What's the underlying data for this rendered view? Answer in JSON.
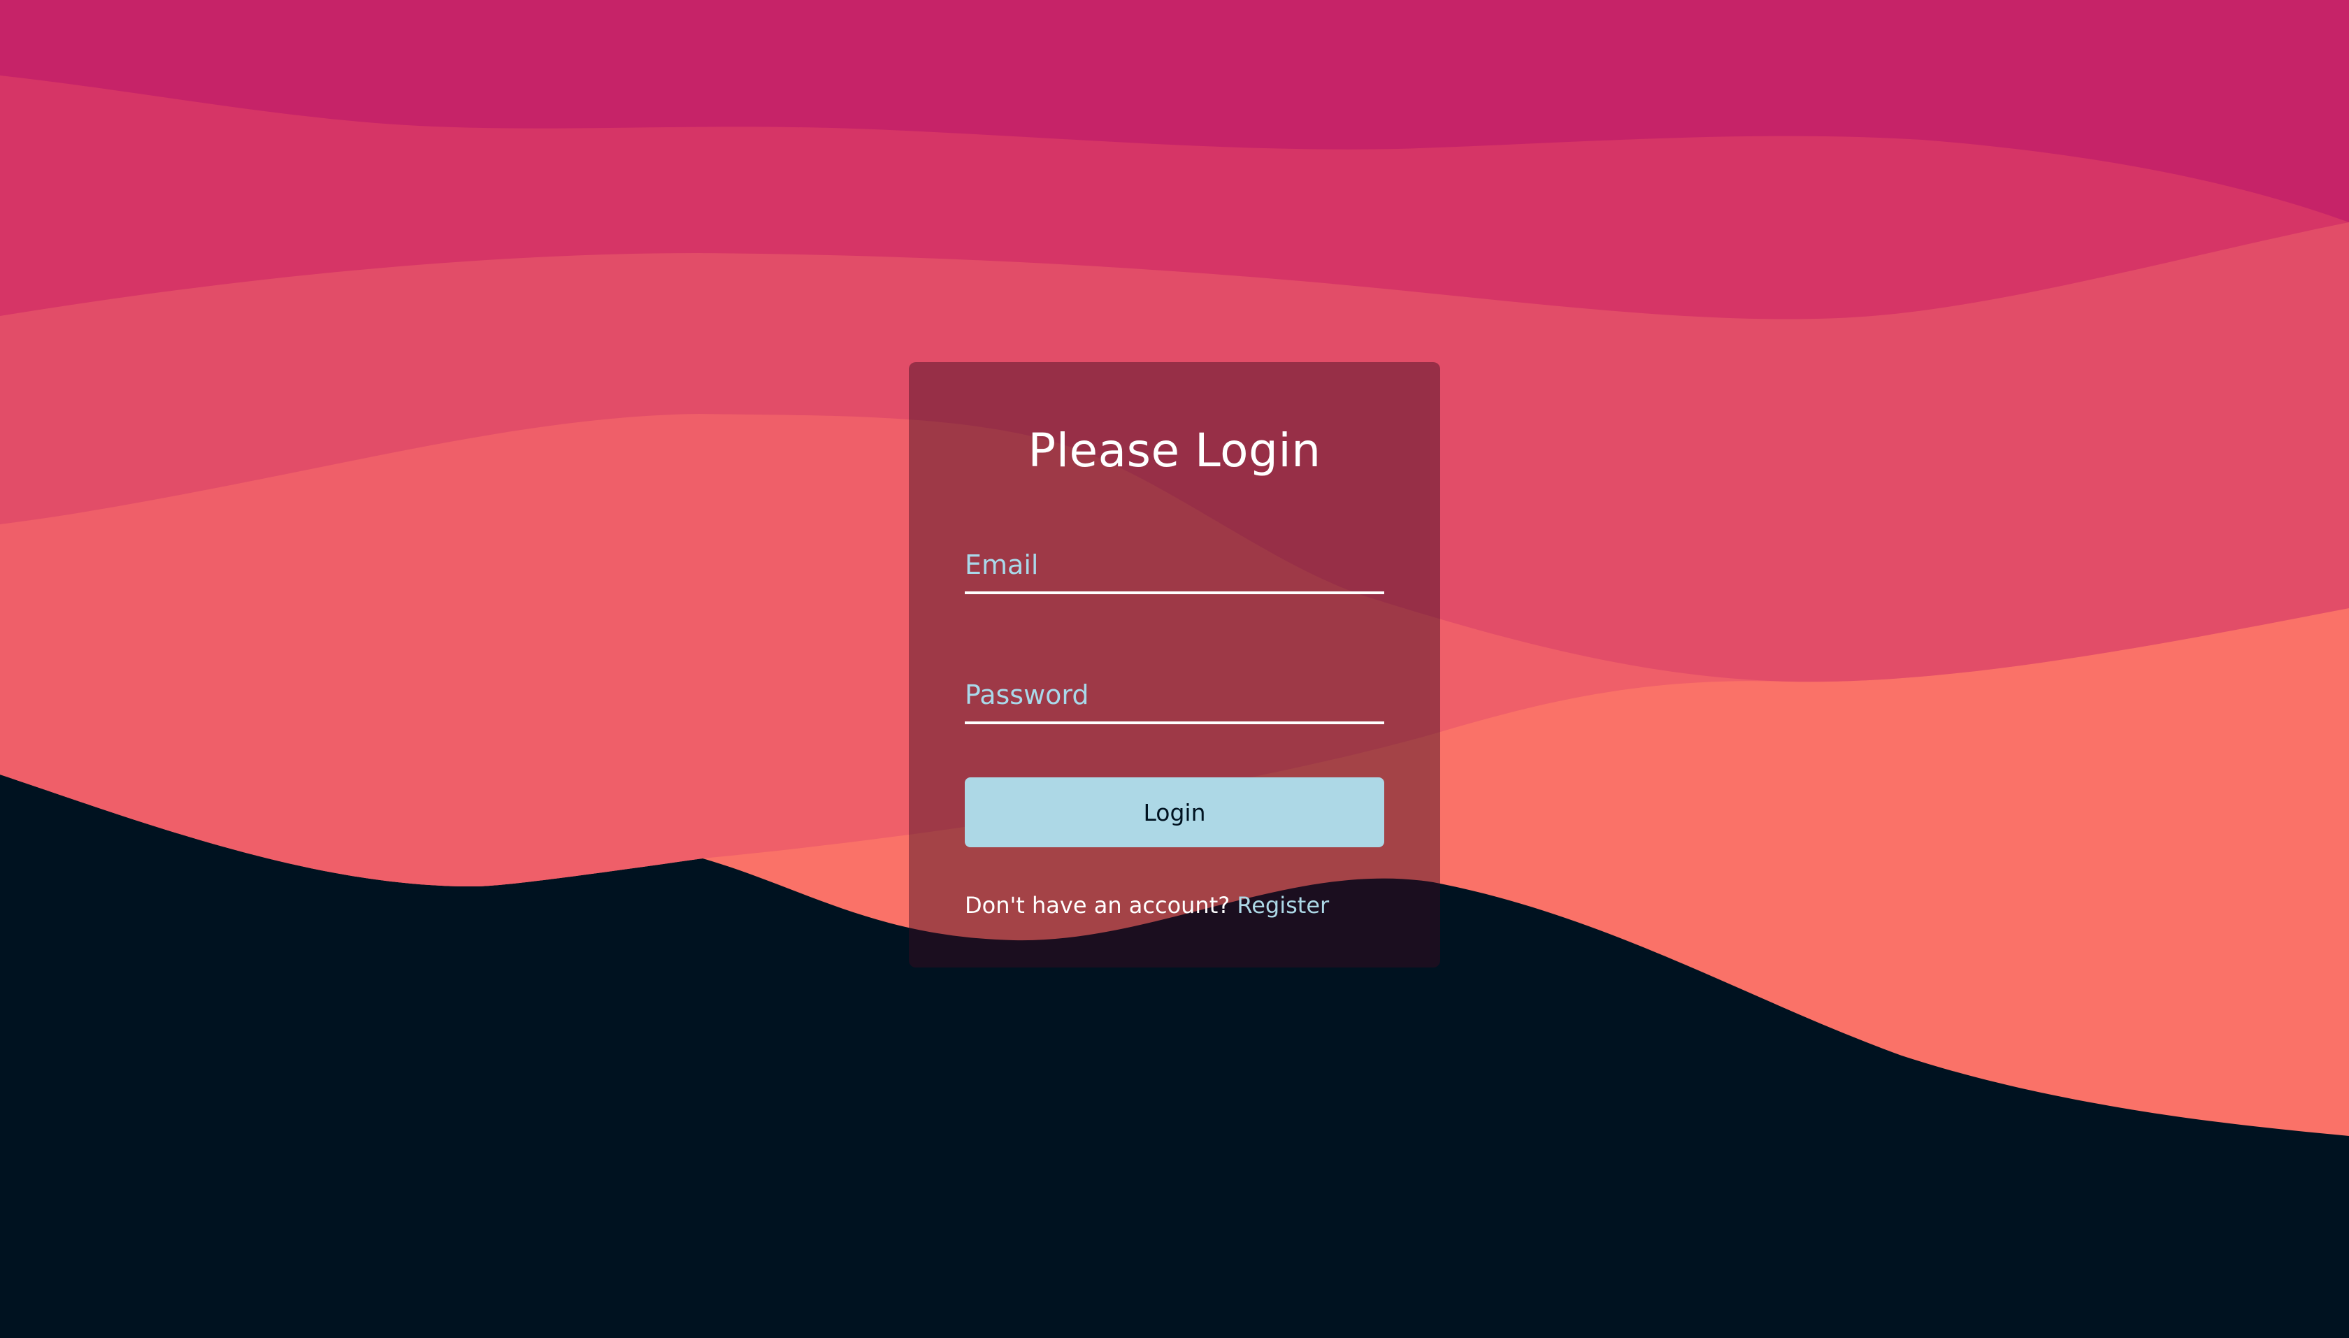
{
  "colors": {
    "background": "#001220",
    "accent": "#add8e6",
    "wave_top": "#c62368",
    "wave_2": "#d63566",
    "wave_3": "#e24d68",
    "wave_4": "#ef5f69",
    "wave_5": "#fa7268"
  },
  "login": {
    "title": "Please Login",
    "email_placeholder": "Email",
    "password_placeholder": "Password",
    "button_label": "Login",
    "footer_text": "Don't have an account? ",
    "register_link": "Register"
  }
}
